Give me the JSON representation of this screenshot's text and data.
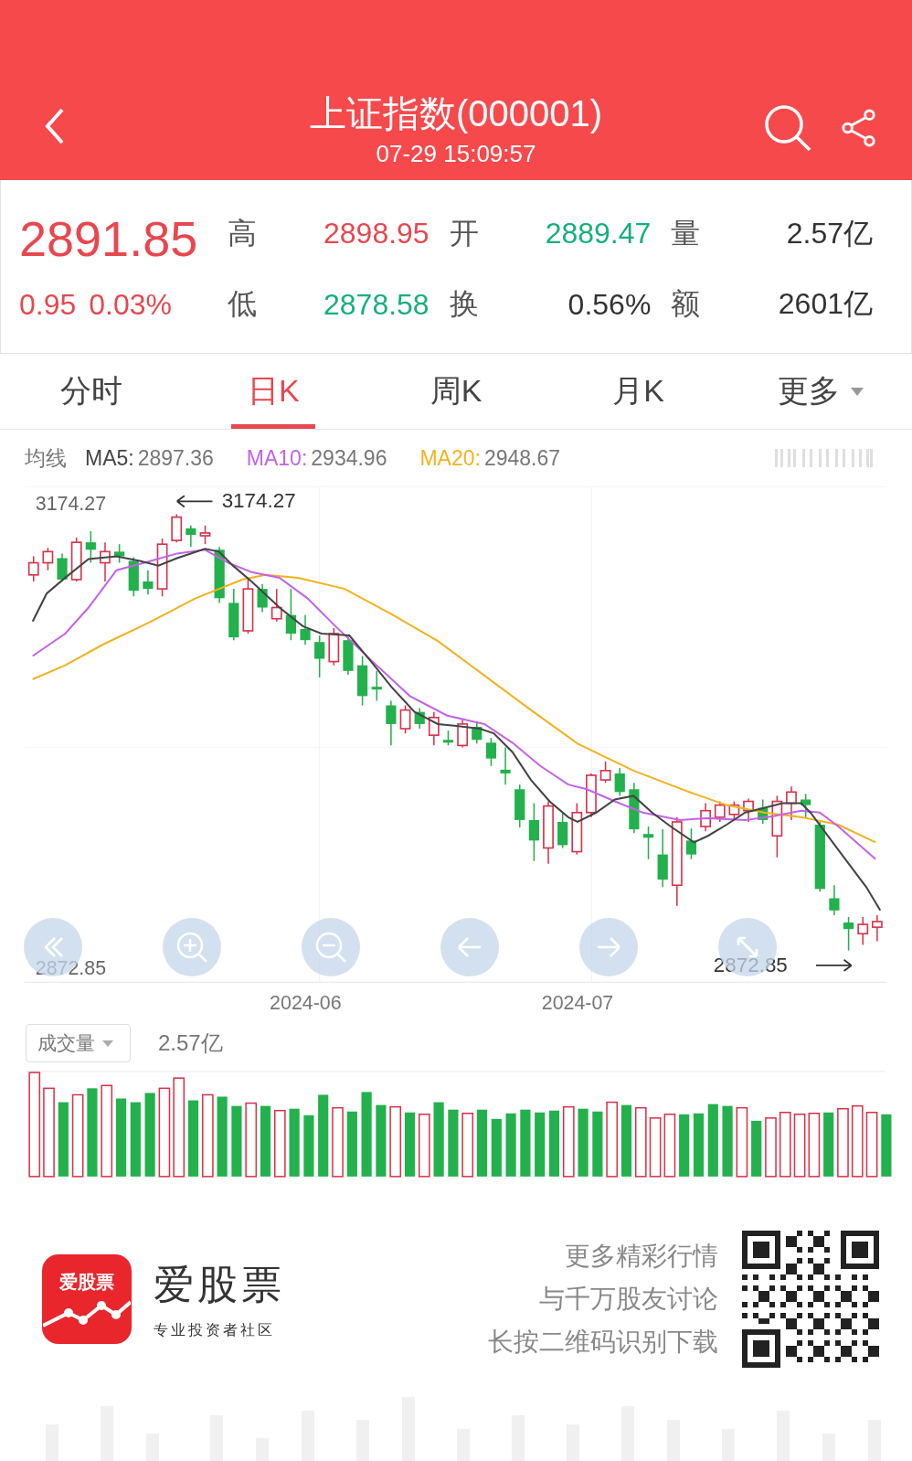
{
  "header": {
    "title": "上证指数(000001)",
    "time": "07-29 15:09:57"
  },
  "quote": {
    "price": "2891.85",
    "change": "0.95",
    "change_pct": "0.03%",
    "color": "#e8474f",
    "stats": [
      {
        "label": "高",
        "value": "2898.95",
        "color": "#e8474f"
      },
      {
        "label": "开",
        "value": "2889.47",
        "color": "#16b07a"
      },
      {
        "label": "量",
        "value": "2.57亿",
        "color": "#333333"
      },
      {
        "label": "低",
        "value": "2878.58",
        "color": "#16b07a"
      },
      {
        "label": "换",
        "value": "0.56%",
        "color": "#333333"
      },
      {
        "label": "额",
        "value": "2601亿",
        "color": "#333333"
      }
    ]
  },
  "tabs": [
    {
      "label": "分时",
      "selected": false,
      "dropdown": false
    },
    {
      "label": "日K",
      "selected": true,
      "dropdown": false
    },
    {
      "label": "周K",
      "selected": false,
      "dropdown": false
    },
    {
      "label": "月K",
      "selected": false,
      "dropdown": false
    },
    {
      "label": "更多",
      "selected": false,
      "dropdown": true
    }
  ],
  "ma": {
    "label": "均线",
    "lines": [
      {
        "name": "MA5:",
        "value": "2897.36",
        "color": "#444444"
      },
      {
        "name": "MA10:",
        "value": "2934.96",
        "color": "#c463e6"
      },
      {
        "name": "MA20:",
        "value": "2948.67",
        "color": "#f2b21c"
      }
    ]
  },
  "chart": {
    "max_label": "3174.27",
    "max_marker": "3174.27",
    "min_label": "2872.85",
    "min_marker": "2872.85",
    "dates": [
      "2024-06",
      "2024-07"
    ]
  },
  "volume": {
    "selector": "成交量",
    "value": "2.57亿"
  },
  "footer": {
    "icon_text": "爱股票",
    "app_name": "爱股票",
    "tagline": "专业投资者社区",
    "promo": [
      "更多精彩行情",
      "与千万股友讨论",
      "长按二维码识别下载"
    ]
  }
}
